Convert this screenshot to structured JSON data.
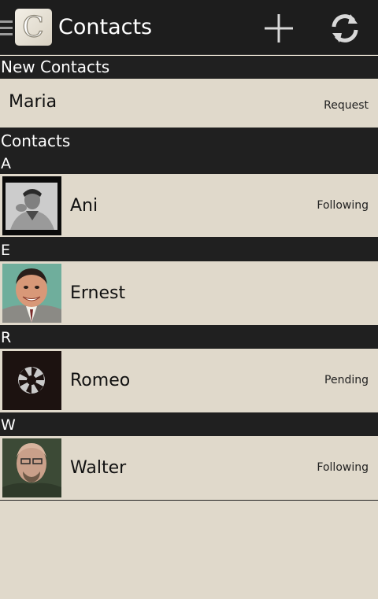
{
  "app": {
    "title": "Contacts"
  },
  "toolbar": {
    "add_icon": "plus-icon",
    "refresh_icon": "refresh-icon"
  },
  "sections": {
    "new_contacts": {
      "header": "New Contacts",
      "items": [
        {
          "name": "Maria",
          "status": "Request"
        }
      ]
    },
    "contacts": {
      "header": "Contacts",
      "groups": [
        {
          "letter": "A",
          "items": [
            {
              "name": "Ani",
              "status": "Following",
              "avatar": "bw-portrait-photo"
            }
          ]
        },
        {
          "letter": "E",
          "items": [
            {
              "name": "Ernest",
              "status": "",
              "avatar": "smiling-man-photo"
            }
          ]
        },
        {
          "letter": "R",
          "items": [
            {
              "name": "Romeo",
              "status": "Pending",
              "avatar": "camera-aperture-icon"
            }
          ]
        },
        {
          "letter": "W",
          "items": [
            {
              "name": "Walter",
              "status": "Following",
              "avatar": "bald-man-photo"
            }
          ]
        }
      ]
    }
  },
  "colors": {
    "appbar": "#1d1d1d",
    "row_bg": "#e0d9cb",
    "header_bg": "#202020"
  }
}
